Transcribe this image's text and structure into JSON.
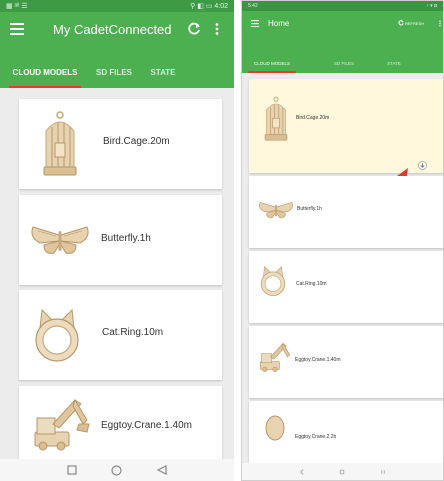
{
  "left": {
    "status": {
      "left": "▦ ᵃˡˡ ☰",
      "right": "⚲ ◧ ▭ 4:02"
    },
    "appbar": {
      "title": "My CadetConnected",
      "menu_icon": "hamburger-menu-icon",
      "refresh_icon": "refresh-icon",
      "more_icon": "more-vert-icon"
    },
    "tabs": [
      "CLOUD MODELS",
      "SD FILES",
      "STATE"
    ],
    "active_tab": 0,
    "models": [
      {
        "name": "Bird.Cage.20m",
        "icon": "bird-cage-thumbnail"
      },
      {
        "name": "Butterfly.1h",
        "icon": "butterfly-thumbnail"
      },
      {
        "name": "Cat.Ring.10m",
        "icon": "cat-ring-thumbnail"
      },
      {
        "name": "Eggtoy.Crane.1.40m",
        "icon": "crane-thumbnail"
      }
    ],
    "nav": [
      "recent-apps-icon",
      "home-icon",
      "back-icon"
    ]
  },
  "right": {
    "status": {
      "left": "5:42",
      "right": "◔ ▾ ◘"
    },
    "appbar": {
      "title": "Home",
      "refresh_label": "REFRESH",
      "menu_icon": "hamburger-menu-icon",
      "refresh_icon": "refresh-icon",
      "more_icon": "more-vert-icon"
    },
    "tabs": [
      "CLOUD MODELS",
      "SD FILES",
      "STATE"
    ],
    "active_tab": 0,
    "models": [
      {
        "name": "Bird.Cage.20m",
        "icon": "bird-cage-thumbnail",
        "highlighted": true
      },
      {
        "name": "Butterfly.1h",
        "icon": "butterfly-thumbnail"
      },
      {
        "name": "Cat.Ring.10m",
        "icon": "cat-ring-thumbnail"
      },
      {
        "name": "Eggtoy.Crane.1.40m",
        "icon": "crane-thumbnail"
      },
      {
        "name": "Eggtoy.Crane.2.2h",
        "icon": "egg-thumbnail"
      }
    ],
    "download_icon": "download-icon",
    "annotation": "red-arrow-pointer",
    "nav": [
      "back-icon",
      "home-icon",
      "recent-apps-icon"
    ]
  },
  "colors": {
    "appbar": "#4caf50",
    "statusbar": "#3e9a45",
    "tab_indicator": "#e53935",
    "highlight": "#fff8dc",
    "arrow": "#e53935",
    "wood": "#e8d3b0"
  }
}
